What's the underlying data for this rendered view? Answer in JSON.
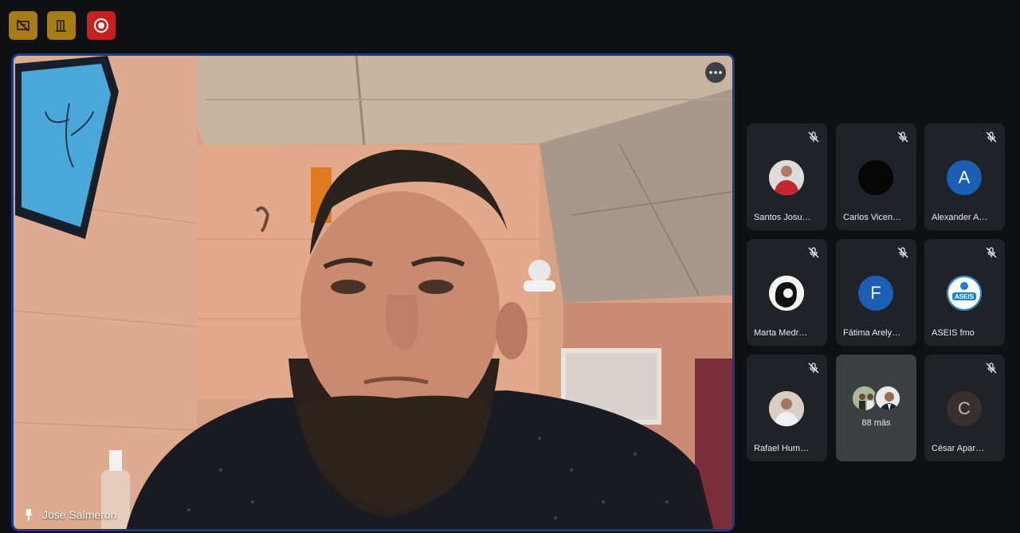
{
  "toolbar": {
    "buttons": [
      {
        "name": "present-toggle",
        "icon": "no-share-icon",
        "color": "#a77c14"
      },
      {
        "name": "leave-room",
        "icon": "door-icon",
        "color": "#a77c14"
      },
      {
        "name": "recording",
        "icon": "record-icon",
        "color": "#c5221f"
      }
    ]
  },
  "main": {
    "speaker_name": "Jose Salmeron",
    "pinned": true,
    "menu_icon": "more-horizontal-icon",
    "border_color": "#1a3a8a"
  },
  "participants": [
    {
      "name": "Santos Josu…",
      "avatar_type": "photo",
      "mic_muted": true
    },
    {
      "name": "Carlos Vicen…",
      "avatar_type": "photo-dark",
      "mic_muted": true
    },
    {
      "name": "Alexander A…",
      "avatar_type": "initial",
      "initial": "A",
      "avatar_color": "#1a5fb4",
      "mic_muted": true
    },
    {
      "name": "Marta Medr…",
      "avatar_type": "photo",
      "mic_muted": true
    },
    {
      "name": "Fátima Arely…",
      "avatar_type": "initial",
      "initial": "F",
      "avatar_color": "#1a5fb4",
      "mic_muted": true
    },
    {
      "name": "ASEIS fmo",
      "avatar_type": "logo",
      "logo_text": "ASEIS",
      "mic_muted": true
    },
    {
      "name": "Rafael Hum…",
      "avatar_type": "photo",
      "mic_muted": true
    },
    {
      "name": "César Apar…",
      "avatar_type": "initial-dim",
      "initial": "C",
      "mic_muted": true
    }
  ],
  "more_tile": {
    "label": "88 más"
  }
}
